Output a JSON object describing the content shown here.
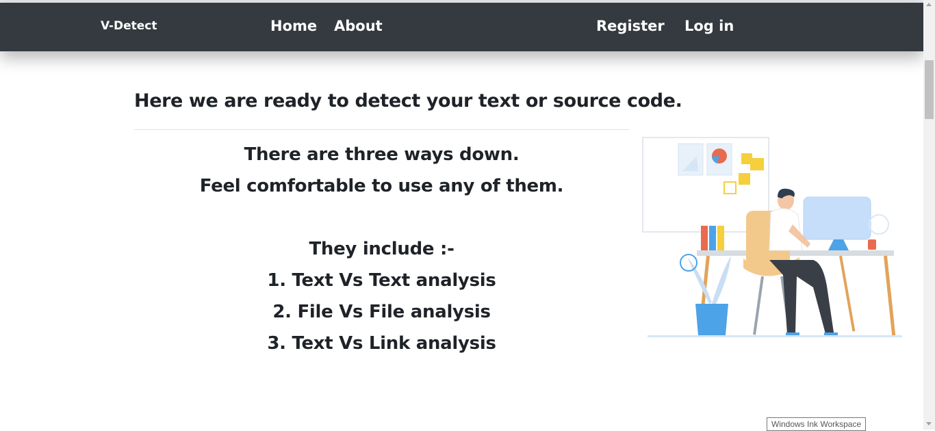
{
  "nav": {
    "brand": "V-Detect",
    "home": "Home",
    "about": "About",
    "register": "Register",
    "login": "Log in"
  },
  "main": {
    "heading": "Here we are ready to detect your text or source code.",
    "line1": "There are three ways down.",
    "line2": "Feel comfortable to use any of them.",
    "include_label": "They include :-",
    "options": [
      "1. Text Vs Text analysis",
      "2. File Vs File analysis",
      "3. Text Vs Link analysis"
    ]
  },
  "tooltip": "Windows Ink Workspace",
  "colors": {
    "navbar": "#343a40",
    "text": "#1f2328",
    "accent_blue": "#4da3e8",
    "accent_orange": "#f0b060"
  }
}
